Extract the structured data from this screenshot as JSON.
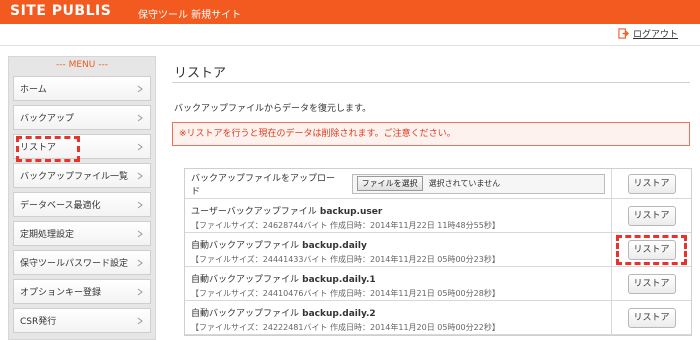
{
  "header": {
    "brand": "SITE PUBLIS",
    "subtitle": "保守ツール 新規サイト"
  },
  "logout_label": "ログアウト",
  "menu": {
    "title": "--- MENU ---",
    "items": [
      {
        "label": "ホーム"
      },
      {
        "label": "バックアップ"
      },
      {
        "label": "リストア"
      },
      {
        "label": "バックアップファイル一覧"
      },
      {
        "label": "データベース最適化"
      },
      {
        "label": "定期処理設定"
      },
      {
        "label": "保守ツールパスワード設定"
      },
      {
        "label": "オプションキー登録"
      },
      {
        "label": "CSR発行"
      }
    ]
  },
  "page": {
    "title": "リストア",
    "description": "バックアップファイルからデータを復元します。",
    "warning": "※リストアを行うと現在のデータは削除されます。ご注意ください。"
  },
  "upload": {
    "label": "バックアップファイルをアップロード",
    "file_button": "ファイルを選択",
    "file_status": "選択されていません"
  },
  "restore_label": "リストア",
  "backups": [
    {
      "prefix": "ユーザーバックアップファイル",
      "name": "backup.user",
      "meta": "【ファイルサイズ：24628744バイト 作成日時：2014年11月22日 11時48分55秒】"
    },
    {
      "prefix": "自動バックアップファイル",
      "name": "backup.daily",
      "meta": "【ファイルサイズ：24441433バイト 作成日時：2014年11月22日 05時00分23秒】"
    },
    {
      "prefix": "自動バックアップファイル",
      "name": "backup.daily.1",
      "meta": "【ファイルサイズ：24410476バイト 作成日時：2014年11月21日 05時00分28秒】"
    },
    {
      "prefix": "自動バックアップファイル",
      "name": "backup.daily.2",
      "meta": "【ファイルサイズ：24222481バイト 作成日時：2014年11月20日 05時00分22秒】"
    }
  ]
}
